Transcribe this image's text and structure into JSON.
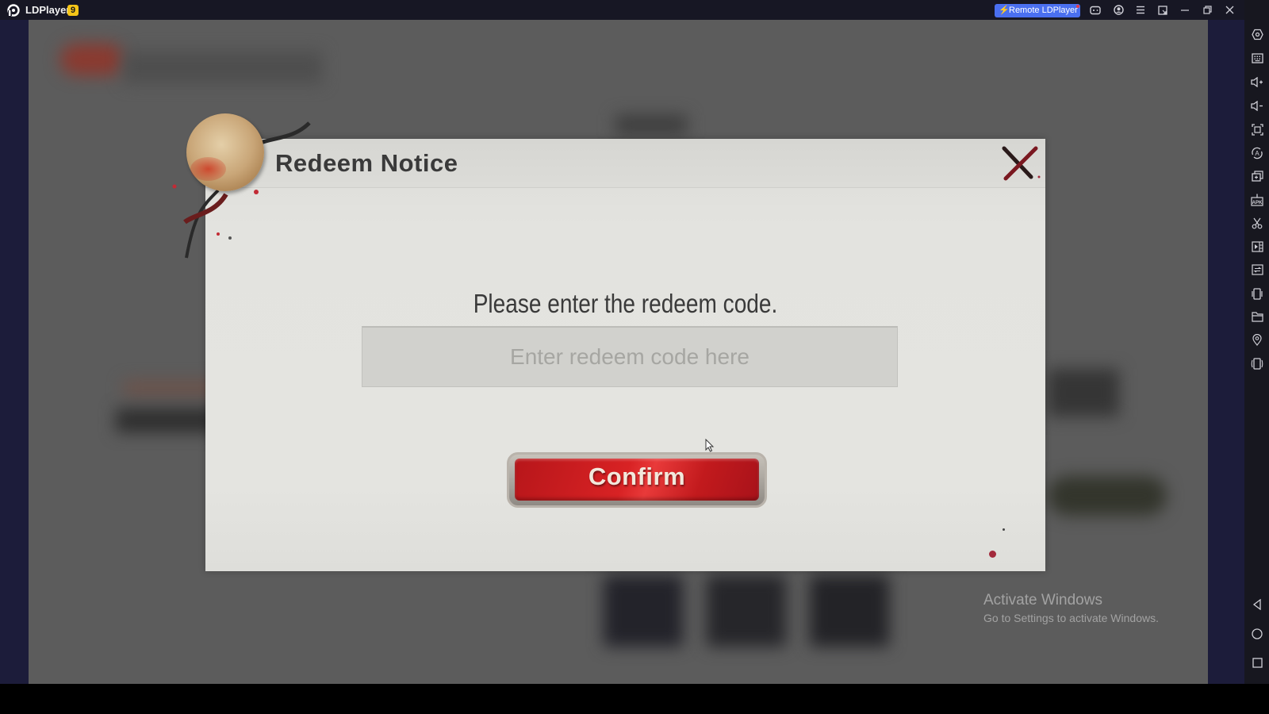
{
  "window": {
    "app_title": "LDPlayer",
    "version_badge": "9",
    "remote_button_label": "Remote LDPlayer",
    "title_icons": [
      "gamepad-icon",
      "account-icon",
      "menu-icon",
      "screen-record-icon",
      "minimize-icon",
      "restore-icon",
      "close-icon",
      "collapse-sidebar-icon"
    ]
  },
  "sidebar": {
    "items": [
      {
        "name": "settings-icon",
        "glyph": "⬡"
      },
      {
        "name": "keyboard-mapping-icon",
        "glyph": "⌨"
      },
      {
        "name": "volume-up-icon",
        "glyph": "🔈+"
      },
      {
        "name": "volume-down-icon",
        "glyph": "🔈-"
      },
      {
        "name": "screenshot-icon",
        "glyph": "⛶"
      },
      {
        "name": "auto-rotate-icon",
        "glyph": "Ⓐ"
      },
      {
        "name": "multi-instance-icon",
        "glyph": "⧉"
      },
      {
        "name": "install-apk-icon",
        "glyph": "APK"
      },
      {
        "name": "scissors-icon",
        "glyph": "✂"
      },
      {
        "name": "video-record-icon",
        "glyph": "▶"
      },
      {
        "name": "sync-icon",
        "glyph": "⇄"
      },
      {
        "name": "shake-icon",
        "glyph": "▯"
      },
      {
        "name": "folder-icon",
        "glyph": "🗀"
      },
      {
        "name": "location-icon",
        "glyph": "⌖"
      },
      {
        "name": "rotate-screen-icon",
        "glyph": "▯"
      }
    ],
    "nav": [
      {
        "name": "back-icon",
        "glyph": "◁"
      },
      {
        "name": "home-icon",
        "glyph": "○"
      },
      {
        "name": "recents-icon",
        "glyph": "□"
      }
    ]
  },
  "dialog": {
    "title": "Redeem Notice",
    "prompt": "Please enter the redeem code.",
    "input_value": "",
    "input_placeholder": "Enter redeem code here",
    "confirm_label": "Confirm"
  },
  "watermark": {
    "line1": "Activate Windows",
    "line2": "Go to Settings to activate Windows."
  },
  "colors": {
    "titlebar": "#171724",
    "remote_button": "#4a6ff0",
    "badge": "#f5c518",
    "confirm_red": "#d82224"
  }
}
